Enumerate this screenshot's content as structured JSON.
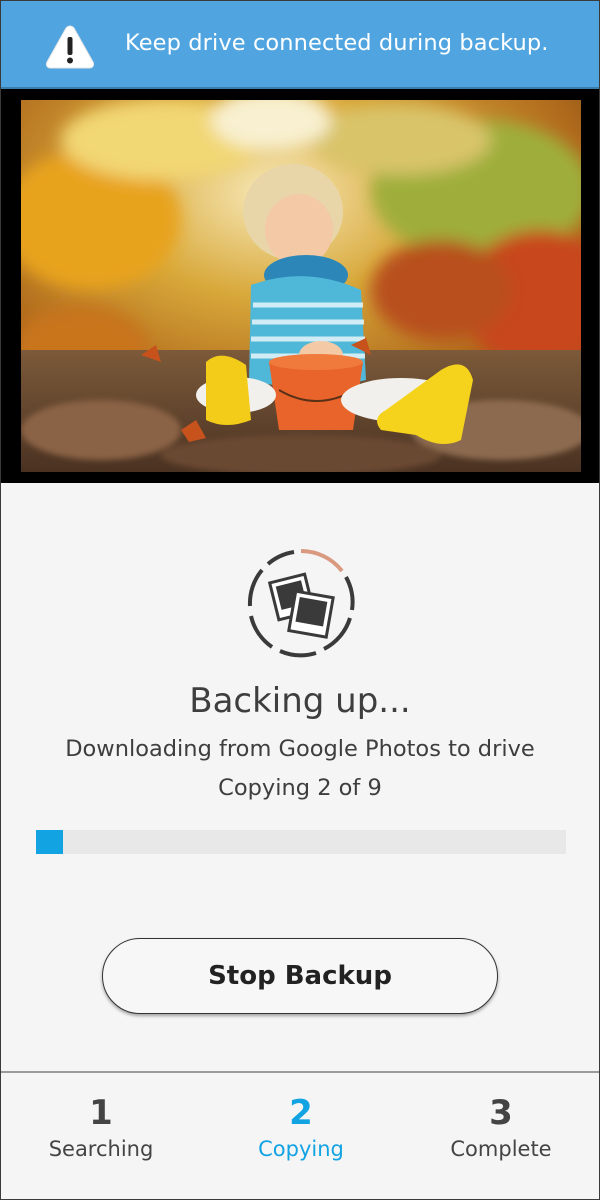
{
  "banner": {
    "icon": "warning-icon",
    "message": "Keep drive connected during backup.",
    "color": "#50a5e0"
  },
  "photo": {
    "description_icon": "photo-preview"
  },
  "status": {
    "icon": "photos-sync-icon",
    "title": "Backing up...",
    "subtitle": "Downloading from Google Photos to drive",
    "progress_text": "Copying 2 of 9",
    "progress_fraction": 0.05,
    "accent_color": "#12a3e3"
  },
  "actions": {
    "stop_label": "Stop Backup"
  },
  "steps": [
    {
      "number": "1",
      "label": "Searching",
      "active": false
    },
    {
      "number": "2",
      "label": "Copying",
      "active": true
    },
    {
      "number": "3",
      "label": "Complete",
      "active": false
    }
  ]
}
